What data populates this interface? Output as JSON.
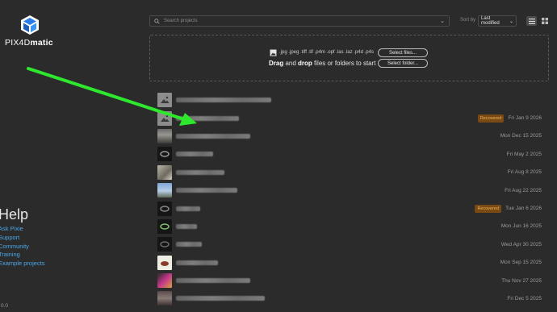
{
  "app": {
    "logo_prefix": "PIX4D",
    "logo_suffix": "matic",
    "version": "0.0"
  },
  "search": {
    "placeholder": "Search projects"
  },
  "sort": {
    "label": "Sort by",
    "value": "Last modified"
  },
  "dropzone": {
    "formats": ".jpg .jpeg .tiff .tif .p4m .opf .las .laz .p4d .p4s",
    "drag": "Drag",
    "and": " and ",
    "drop": "drop",
    "rest": " files or folders to start",
    "select_files": "Select files...",
    "select_folder": "Select folder..."
  },
  "help": {
    "title": "Help",
    "links": [
      "Ask Pixie",
      "Support",
      "Community",
      "Training",
      "Example projects"
    ]
  },
  "colors": {
    "accent_link": "#4aa7e8",
    "badge_bg": "#7a4a14",
    "badge_text": "#f0b15a",
    "arrow": "#2ee82e"
  },
  "projects": [
    {
      "date": "",
      "badge": "",
      "thumb": "placeholder"
    },
    {
      "date": "Fri Jan 9 2026",
      "badge": "Recovered",
      "thumb": "placeholder"
    },
    {
      "date": "Mon Dec 15 2025",
      "badge": "",
      "thumb": "rocky"
    },
    {
      "date": "Fri May 2 2025",
      "badge": "",
      "thumb": "dark-ring"
    },
    {
      "date": "Fri Aug 8 2025",
      "badge": "",
      "thumb": "statue"
    },
    {
      "date": "Fri Aug 22 2025",
      "badge": "",
      "thumb": "sky"
    },
    {
      "date": "Tue Jan 6 2026",
      "badge": "Recovered",
      "thumb": "dark-ring"
    },
    {
      "date": "Mon Jun 16 2025",
      "badge": "",
      "thumb": "green-ring"
    },
    {
      "date": "Wed Apr 30 2025",
      "badge": "",
      "thumb": "dark-ring"
    },
    {
      "date": "Mon Sep 15 2025",
      "badge": "",
      "thumb": "object"
    },
    {
      "date": "Thu Nov 27 2025",
      "badge": "",
      "thumb": "pink"
    },
    {
      "date": "Fri Dec 5 2025",
      "badge": "",
      "thumb": "crowd"
    }
  ]
}
